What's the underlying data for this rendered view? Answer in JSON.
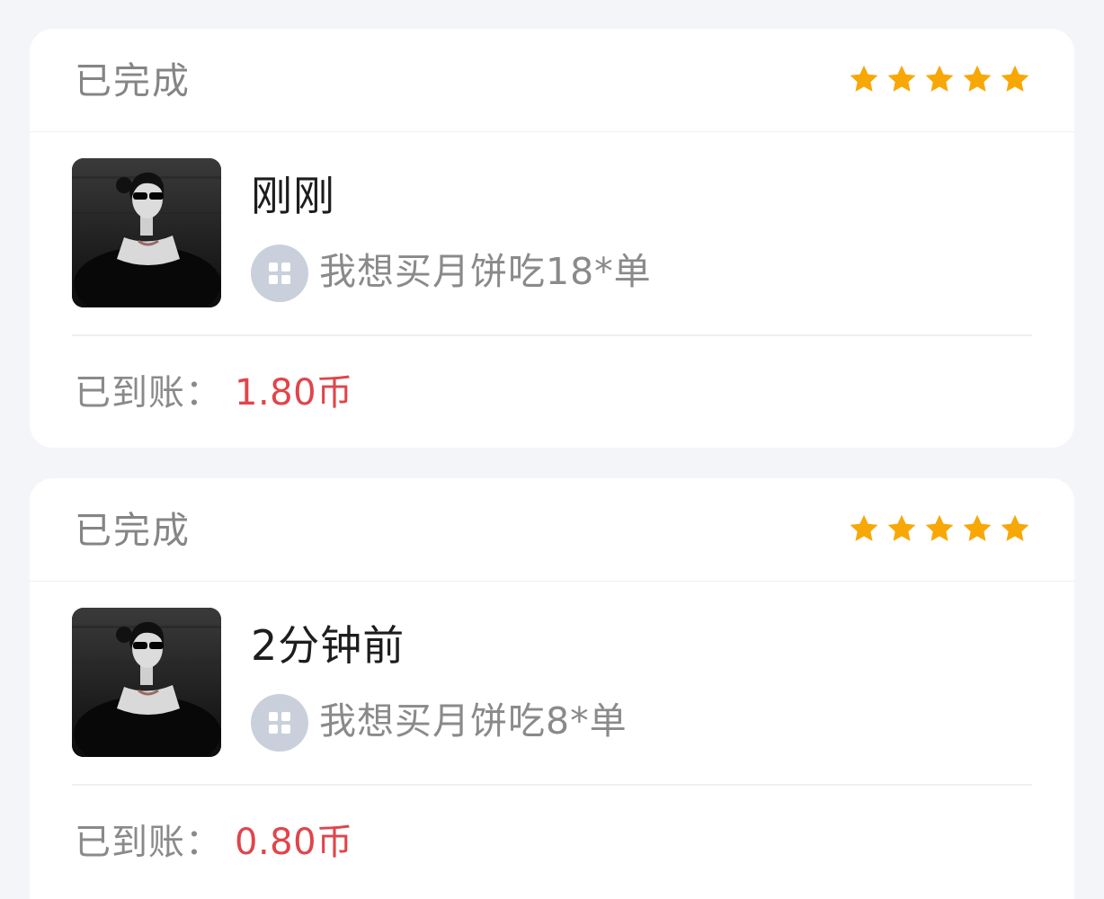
{
  "colors": {
    "background": "#f3f5f8",
    "card": "#ffffff",
    "star": "#f7a807",
    "amount": "#e0454a",
    "muted_text": "#858585"
  },
  "orders": [
    {
      "status": "已完成",
      "rating": 5,
      "avatar_icon": "user-avatar-photo",
      "time": "刚刚",
      "service_icon": "grid-apps-icon",
      "service": "我想买月饼吃18*单",
      "paid_label": "已到账：",
      "amount": "1.80币"
    },
    {
      "status": "已完成",
      "rating": 5,
      "avatar_icon": "user-avatar-photo",
      "time": "2分钟前",
      "service_icon": "grid-apps-icon",
      "service": "我想买月饼吃8*单",
      "paid_label": "已到账：",
      "amount": "0.80币"
    }
  ]
}
